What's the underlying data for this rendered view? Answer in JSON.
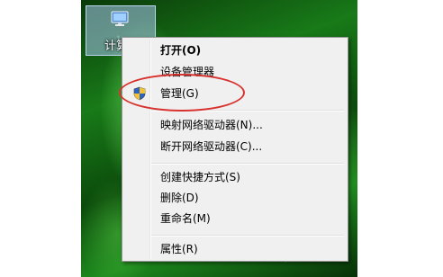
{
  "desktop": {
    "icon": {
      "name": "computer-icon",
      "label": "计算"
    }
  },
  "context_menu": {
    "items": [
      {
        "label": "打开(O)",
        "bold": true
      },
      {
        "label": "设备管理器"
      },
      {
        "label": "管理(G)",
        "icon": "uac-shield-icon"
      },
      {
        "label": "映射网络驱动器(N)..."
      },
      {
        "label": "断开网络驱动器(C)..."
      },
      {
        "label": "创建快捷方式(S)"
      },
      {
        "label": "删除(D)"
      },
      {
        "label": "重命名(M)"
      },
      {
        "label": "属性(R)"
      }
    ]
  },
  "annotation": {
    "color": "#d8322f"
  },
  "colors": {
    "menu_background": "#f0f0f0",
    "wallpaper_green": "#187a18"
  }
}
